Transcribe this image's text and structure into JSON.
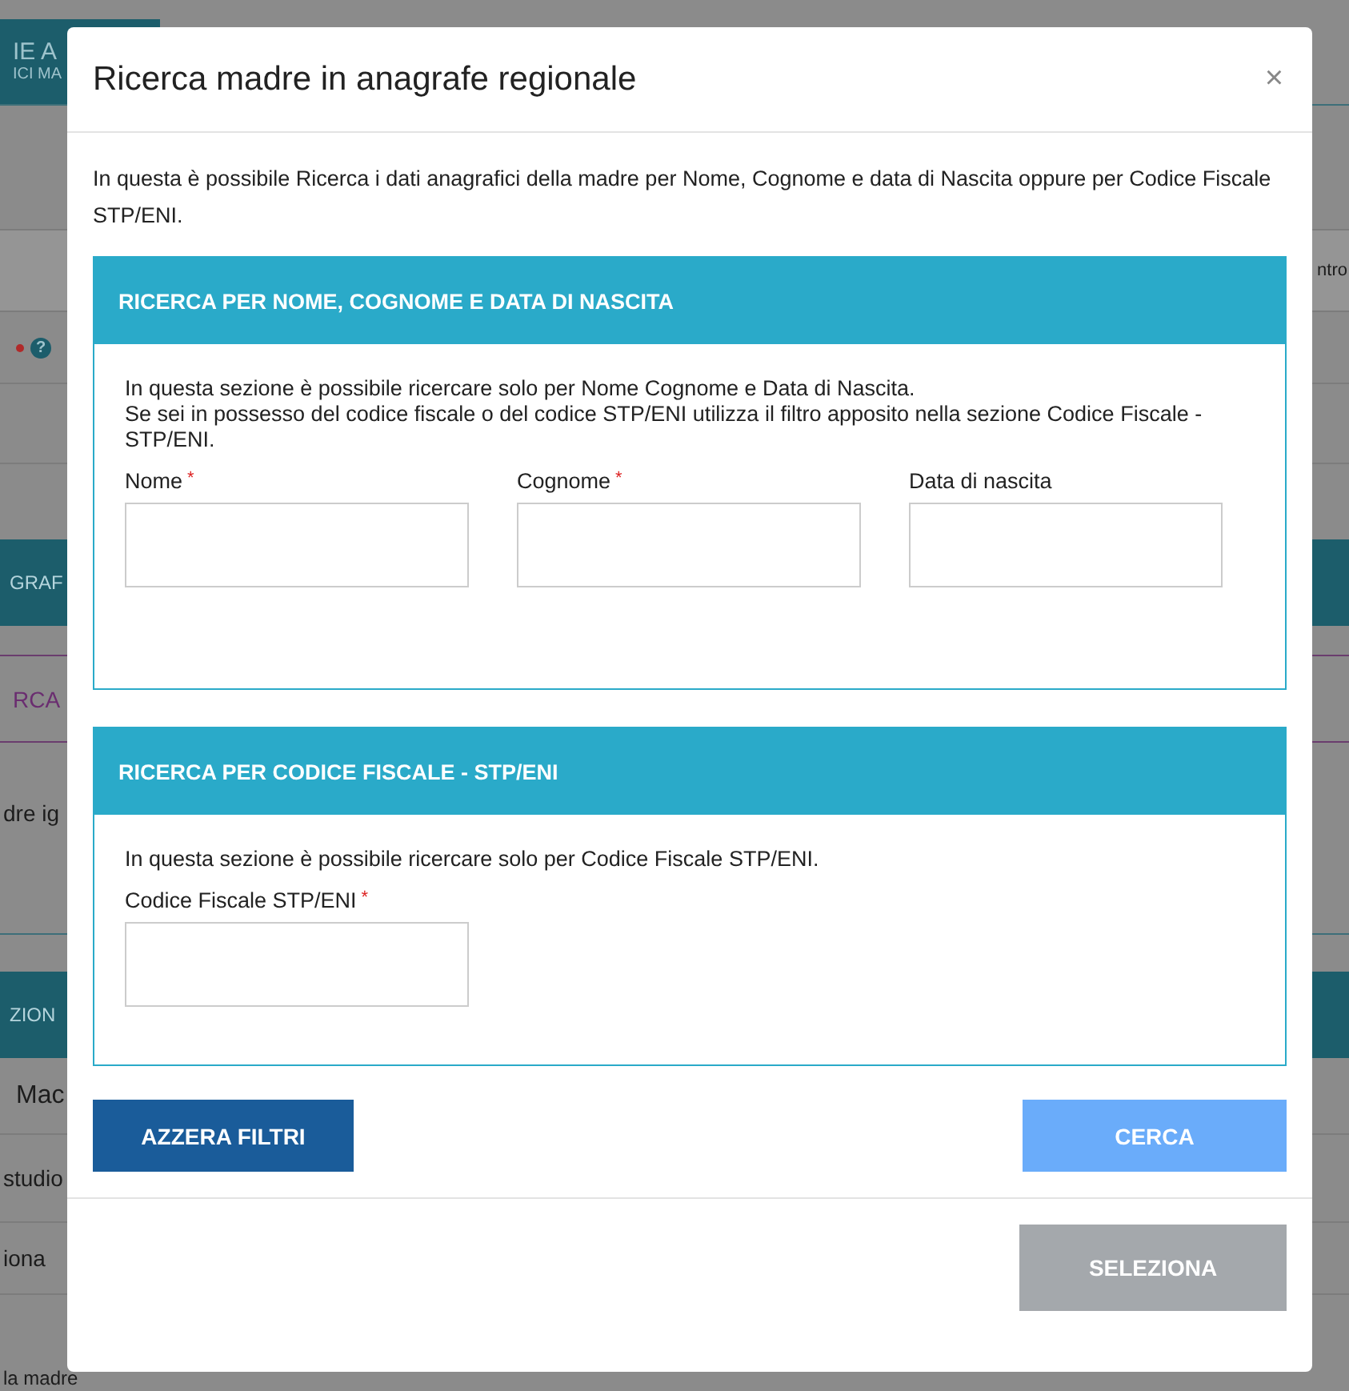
{
  "background": {
    "header_title": "IE A",
    "header_subtitle": "ICI MA",
    "side_label": "ntro",
    "help": "?",
    "section_1": "GRAF",
    "tab": "RCA",
    "hint": "dre ig",
    "section_2": "ZION",
    "field_label": "Mac",
    "row_1": "studio",
    "row_2": "iona",
    "footer": "la madre"
  },
  "dialog": {
    "title": "Ricerca madre in anagrafe regionale",
    "close": "×",
    "intro": "In questa è possibile Ricerca i dati anagrafici della madre per Nome, Cognome e data di Nascita oppure per Codice Fiscale STP/ENI.",
    "panels": [
      {
        "title": "RICERCA PER NOME, COGNOME E DATA DI NASCITA",
        "description": "In questa sezione è possibile ricercare solo per Nome Cognome e Data di Nascita.\nSe sei in possesso del codice fiscale o del codice STP/ENI utilizza il filtro apposito nella sezione Codice Fiscale - STP/ENI.",
        "fields": [
          {
            "label": "Nome",
            "required_mark": "*"
          },
          {
            "label": "Cognome",
            "required_mark": "*"
          },
          {
            "label": "Data di nascita"
          }
        ]
      },
      {
        "title": "RICERCA PER CODICE FISCALE - STP/ENI",
        "description": "In questa sezione è possibile ricercare solo per Codice Fiscale STP/ENI.",
        "fields": [
          {
            "label": "Codice Fiscale STP/ENI",
            "required_mark": "*"
          }
        ]
      }
    ],
    "actions": [
      {
        "label": "AZZERA FILTRI",
        "kind": "secondary"
      },
      {
        "label": "CERCA",
        "kind": "primary"
      }
    ],
    "footer_button": {
      "label": "SELEZIONA",
      "disabled": true
    }
  }
}
